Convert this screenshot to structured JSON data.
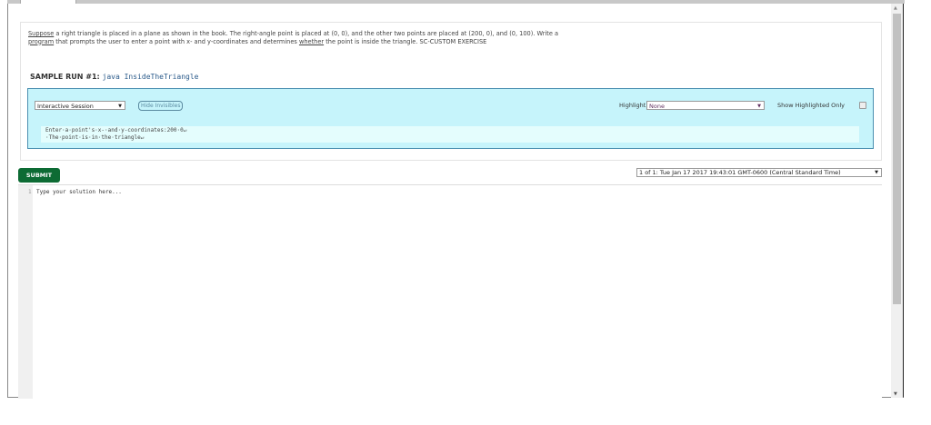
{
  "problem": {
    "w1": "Suppose",
    "t1": " a right triangle is placed in a plane as shown in the book. The right-angle point is placed at (0, 0), and the other two points are placed at (200, 0), and (0, 100). Write a ",
    "w2": "program",
    "t2": " that prompts the user to enter a point with x- and y-coordinates and determines ",
    "w3": "whether",
    "t3": " the point is inside the triangle. SC-CUSTOM EXERCISE"
  },
  "sample": {
    "label": "SAMPLE RUN #1:",
    "command": "java InsideTheTriangle"
  },
  "session": {
    "mode": "Interactive Session",
    "hide_invisibles": "Hide Invisibles",
    "highlight_label": "Highlight:",
    "highlight_value": "None",
    "show_highlighted_only": "Show Highlighted Only",
    "show_highlighted_checked": false,
    "output": [
      "Enter·a·point's·x-·and·y-coordinates:200·0↵",
      "·The·point·is·in·the·triangle↵"
    ]
  },
  "submit_label": "SUBMIT",
  "version": "1 of 1: Tue Jan 17 2017 19:43:01 GMT-0600 (Central Standard Time)",
  "editor": {
    "line": "1",
    "placeholder": "Type your solution here..."
  }
}
